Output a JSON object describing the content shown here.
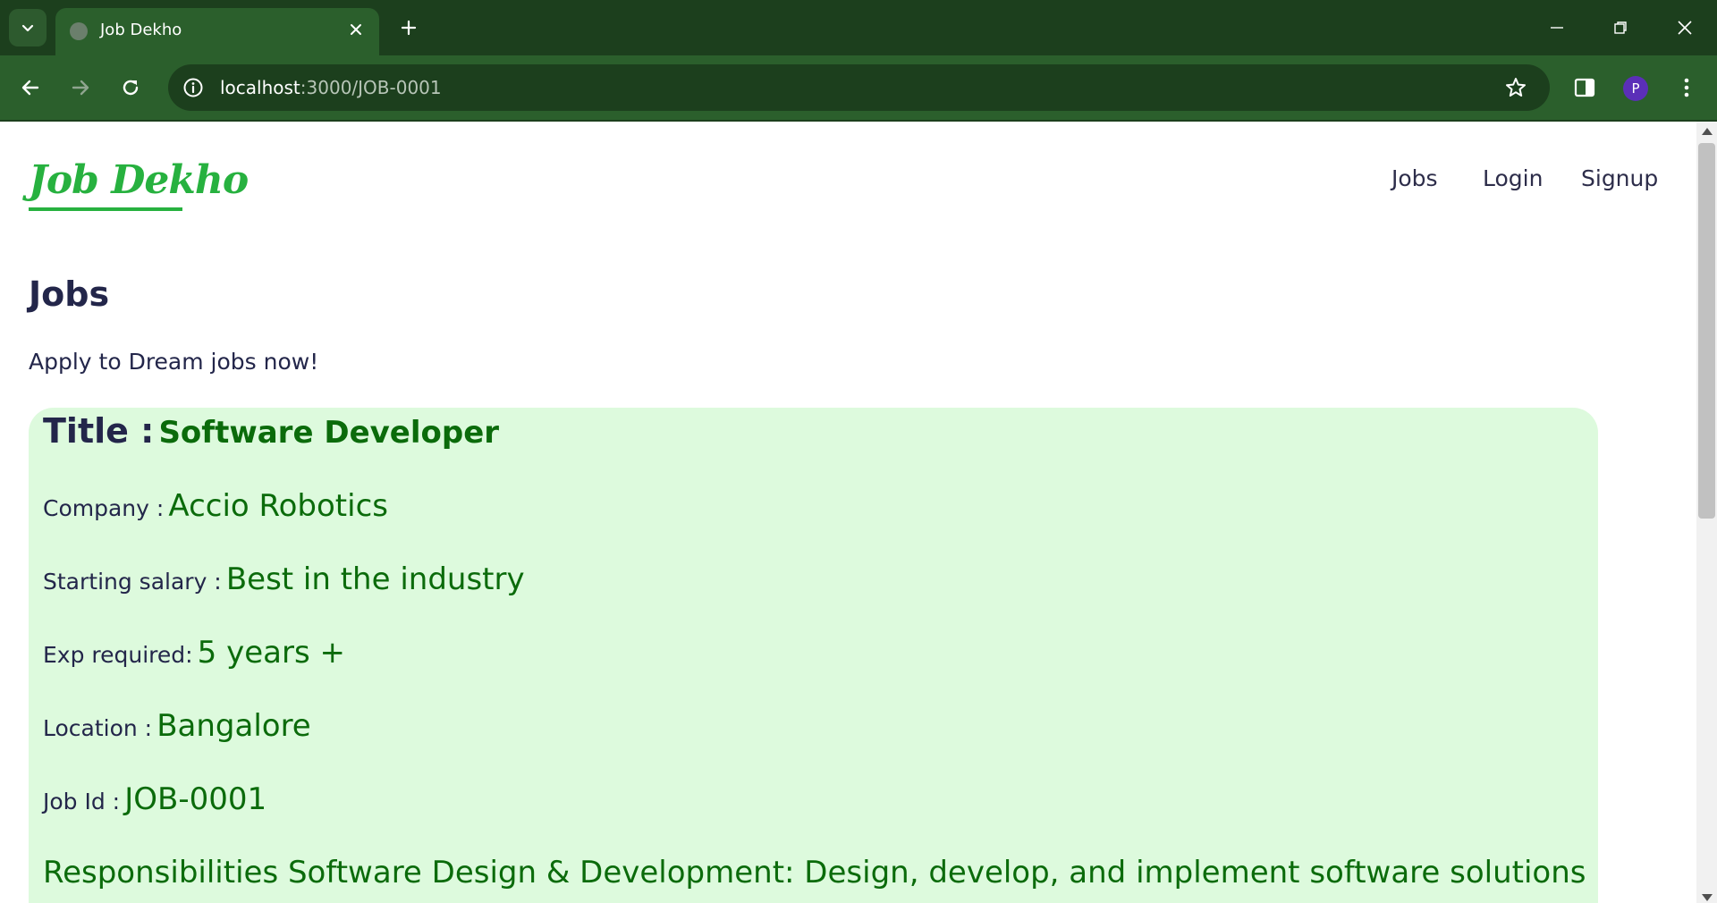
{
  "browser": {
    "tab_title": "Job Dekho",
    "url_host": "localhost",
    "url_path": ":3000/JOB-0001",
    "profile_initial": "P"
  },
  "site": {
    "logo": "Job Dekho",
    "nav": [
      "Jobs",
      "Login",
      "Signup"
    ]
  },
  "main": {
    "heading": "Jobs",
    "tagline": "Apply to Dream jobs now!"
  },
  "job": {
    "title_label": "Title :",
    "title_value": "Software Developer",
    "company_label": "Company :",
    "company_value": "Accio Robotics",
    "salary_label": "Starting salary :",
    "salary_value": "Best in the industry",
    "exp_label": "Exp required:",
    "exp_value": "5 years +",
    "location_label": "Location :",
    "location_value": "Bangalore",
    "jobid_label": "Job Id :",
    "jobid_value": "JOB-0001",
    "responsibilities": "Responsibilities Software Design & Development: Design, develop, and implement software solutions"
  },
  "colors": {
    "chrome_dark": "#1c3f1d",
    "chrome_mid": "#2b5f2c",
    "brand_green": "#27b13f",
    "card_bg": "#ddfadd",
    "value_green": "#0b6b0b",
    "text_navy": "#23264a"
  }
}
